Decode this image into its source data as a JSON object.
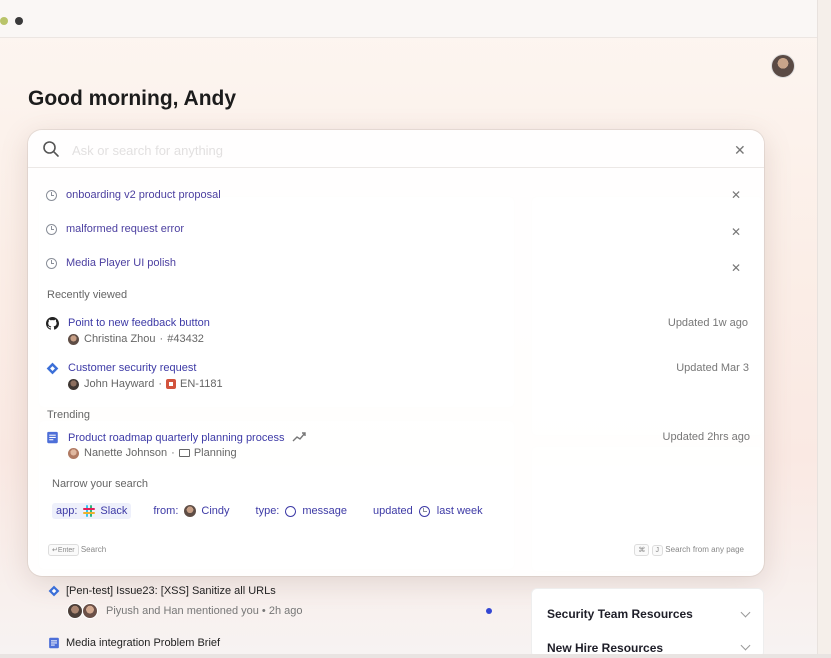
{
  "greeting": "Good morning, Andy",
  "search": {
    "placeholder": "Ask or search for anything"
  },
  "recent_searches": [
    {
      "label": "onboarding v2 product proposal"
    },
    {
      "label": "malformed request error"
    },
    {
      "label": "Media Player UI polish"
    }
  ],
  "recently_viewed": {
    "label": "Recently viewed",
    "items": [
      {
        "title": "Point to new feedback button",
        "icon": "github-icon",
        "author": "Christina Zhou",
        "ref": "#43432",
        "updated": "Updated 1w ago"
      },
      {
        "title": "Customer security request",
        "icon": "jira-diamond-icon",
        "author": "John Hayward",
        "ref": "EN-1181",
        "updated": "Updated Mar 3"
      }
    ]
  },
  "trending": {
    "label": "Trending",
    "items": [
      {
        "title": "Product roadmap quarterly planning process",
        "icon": "doc-icon",
        "author": "Nanette Johnson",
        "folder": "Planning",
        "updated": "Updated 2hrs ago"
      }
    ]
  },
  "narrow": {
    "label": "Narrow your search",
    "chips": [
      {
        "key": "app:",
        "value": "Slack",
        "icon": "slack-icon"
      },
      {
        "key": "from:",
        "value": "Cindy",
        "icon": "avatar"
      },
      {
        "key": "type:",
        "value": "message",
        "icon": "message-icon"
      },
      {
        "key": "updated",
        "value": "last week",
        "icon": "clock-icon"
      }
    ]
  },
  "footer": {
    "enter_key": "↵Enter",
    "enter_label": "Search",
    "cmd_key": "⌘",
    "j_key": "J",
    "shortcut_label": "Search from any page"
  },
  "feed": [
    {
      "title": "[Pen-test] Issue23: [XSS] Sanitize all URLs",
      "meta": "Piyush and Han mentioned you • 2h ago"
    },
    {
      "title": "Media integration Problem Brief"
    }
  ],
  "side_panel": [
    {
      "label": "Security Team Resources"
    },
    {
      "label": "New Hire Resources"
    }
  ],
  "colors": {
    "accent": "#3d3aa6",
    "jira_blue": "#3b6fd8",
    "unread_dot": "#3346d3"
  }
}
